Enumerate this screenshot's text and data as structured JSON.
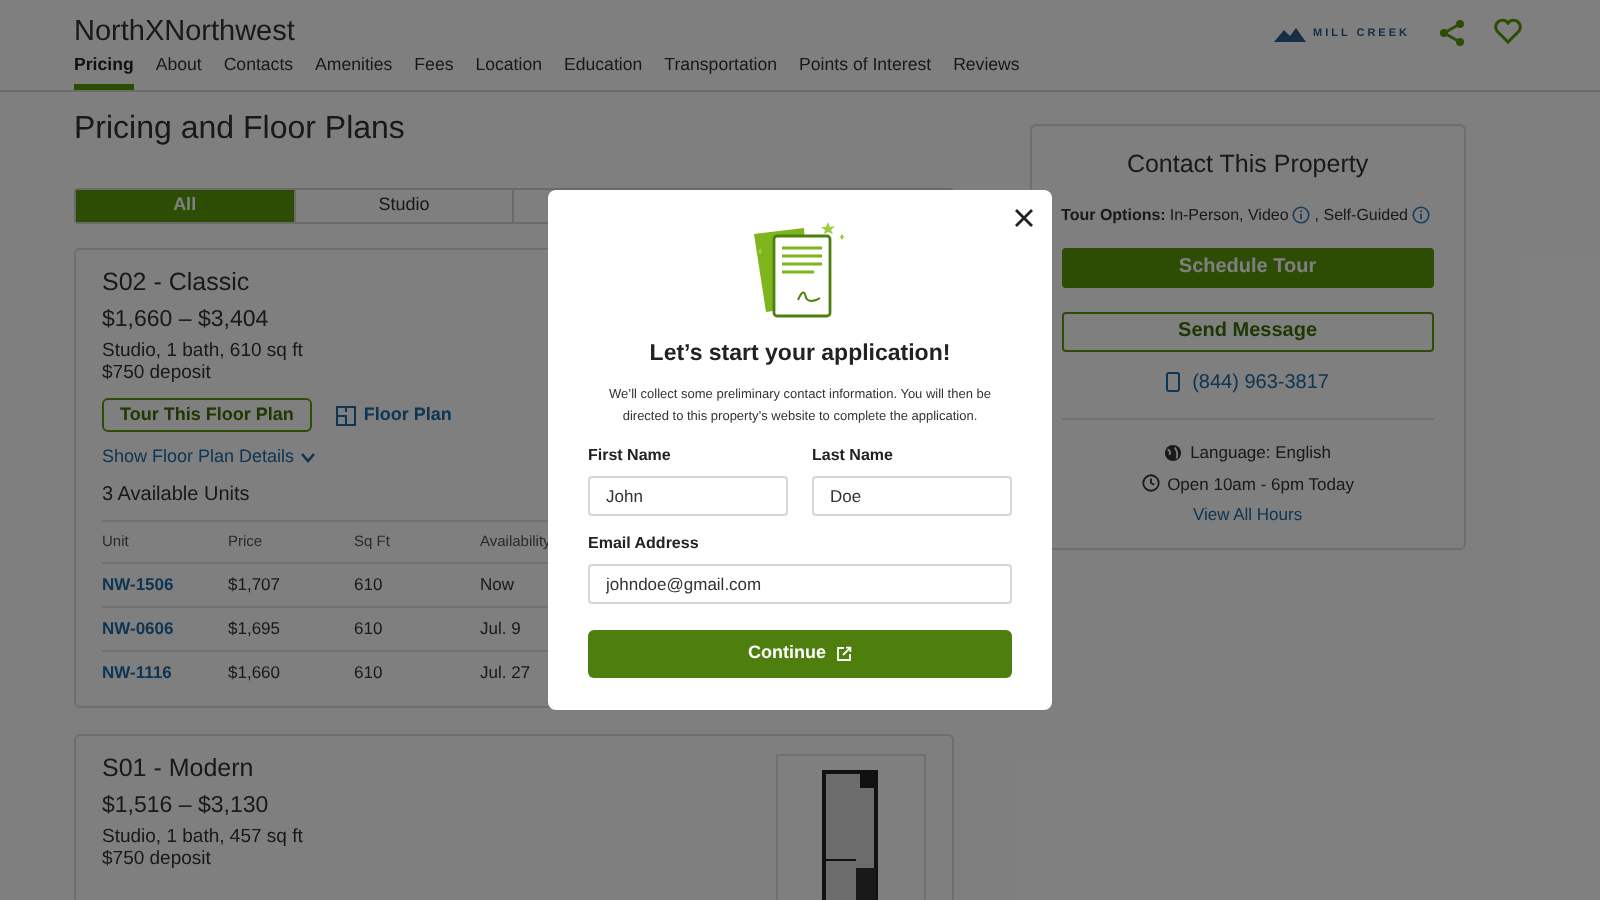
{
  "header": {
    "site_name": "NorthXNorthwest",
    "brand_logo": "MILL CREEK",
    "nav": [
      {
        "label": "Pricing",
        "selected": true
      },
      {
        "label": "About",
        "selected": false
      },
      {
        "label": "Contacts",
        "selected": false
      },
      {
        "label": "Amenities",
        "selected": false
      },
      {
        "label": "Fees",
        "selected": false
      },
      {
        "label": "Location",
        "selected": false
      },
      {
        "label": "Education",
        "selected": false
      },
      {
        "label": "Transportation",
        "selected": false
      },
      {
        "label": "Points of Interest",
        "selected": false
      },
      {
        "label": "Reviews",
        "selected": false
      }
    ]
  },
  "pricing": {
    "title": "Pricing and Floor Plans",
    "tabs": [
      {
        "label": "All",
        "selected": true
      },
      {
        "label": "Studio",
        "selected": false
      }
    ],
    "floor_plans": [
      {
        "name": "S02 - Classic",
        "price_range": "$1,660 – $3,404",
        "details": "Studio, 1 bath, 610 sq ft",
        "deposit": "$750 deposit",
        "tour_button": "Tour This Floor Plan",
        "floor_plan_link": "Floor Plan",
        "details_toggle": "Show Floor Plan Details",
        "units_count": "3 Available Units",
        "table": {
          "columns": [
            "Unit",
            "Price",
            "Sq Ft",
            "Availability"
          ],
          "rows": [
            [
              "NW-1506",
              "$1,707",
              "610",
              "Now"
            ],
            [
              "NW-0606",
              "$1,695",
              "610",
              "Jul. 9"
            ],
            [
              "NW-1116",
              "$1,660",
              "610",
              "Jul. 27"
            ]
          ]
        }
      },
      {
        "name": "S01 - Modern",
        "price_range": "$1,516 – $3,130",
        "details": "Studio, 1 bath, 457 sq ft",
        "deposit": "$750 deposit",
        "has_image": true
      }
    ]
  },
  "contact": {
    "title": "Contact This Property",
    "tour_options_label": "Tour Options:",
    "tour_options": [
      "In-Person, Video",
      ", Self-Guided"
    ],
    "schedule_button": "Schedule Tour",
    "message_button": "Send Message",
    "phone": "(844) 963-3817",
    "language": "Language: English",
    "hours": "Open 10am - 6pm Today",
    "hours_link": "View All Hours"
  },
  "modal": {
    "title": "Let’s start your application!",
    "description": "We’ll collect some preliminary contact information. You will then be directed to this property’s website to complete the application.",
    "fields": [
      {
        "label": "First Name",
        "value": "John"
      },
      {
        "label": "Last Name",
        "value": "Doe"
      },
      {
        "label": "Email Address",
        "value": "johndoe@gmail.com"
      }
    ],
    "continue_button": "Continue"
  }
}
